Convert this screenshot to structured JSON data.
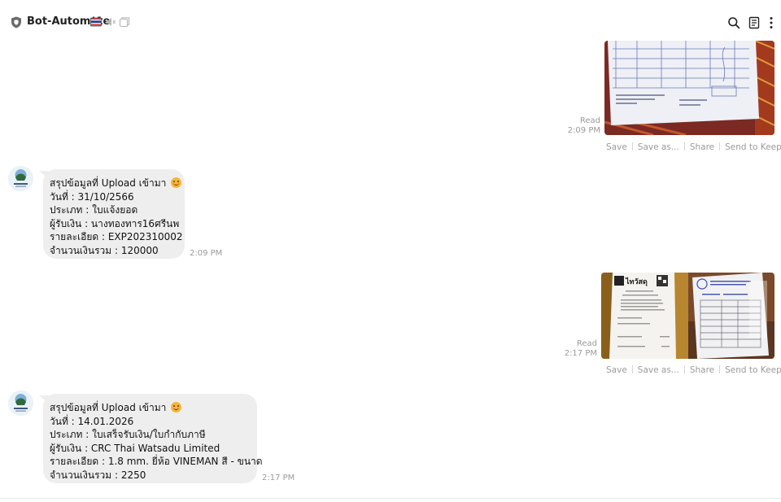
{
  "header": {
    "title": "Bot-Automate",
    "icons": [
      "shield-icon",
      "flag-icon",
      "mute-icon",
      "window-icon",
      "search-icon",
      "notes-icon",
      "more-icon"
    ]
  },
  "messages": [
    {
      "type": "sent-photo",
      "read_label": "Read",
      "time": "2:09 PM",
      "actions": [
        "Save",
        "Save as...",
        "Share",
        "Send to Keep Memo"
      ]
    },
    {
      "type": "received-text",
      "lines": [
        "สรุปข้อมูลที่ Upload เข้ามา",
        "วันที่  : 31/10/2566",
        "ประเภท : ใบแจ้งยอด",
        "ผู้รับเงิน : นางทองทาร16ศรีนพ",
        "รายละเอียด : EXP202310002",
        "จำนวนเงินรวม :  120000"
      ],
      "time": "2:09 PM"
    },
    {
      "type": "sent-photo",
      "read_label": "Read",
      "time": "2:17 PM",
      "actions": [
        "Save",
        "Save as...",
        "Share",
        "Send to Keep Memo"
      ]
    },
    {
      "type": "received-text",
      "lines": [
        "สรุปข้อมูลที่ Upload เข้ามา",
        "วันที่  : 14.01.2026",
        "ประเภท : ใบเสร็จรับเงิน/ใบกำกับภาษี",
        "ผู้รับเงิน : CRC Thai Watsadu Limited",
        "รายละเอียด : 1.8 mm. ยี่ห้อ VINEMAN สี - ขนาด",
        "จำนวนเงินรวม :  2250"
      ],
      "time": "2:17 PM"
    }
  ],
  "colors": {
    "bubble": "#eeeeee",
    "meta_text": "#9a9a9a",
    "title": "#222222"
  }
}
